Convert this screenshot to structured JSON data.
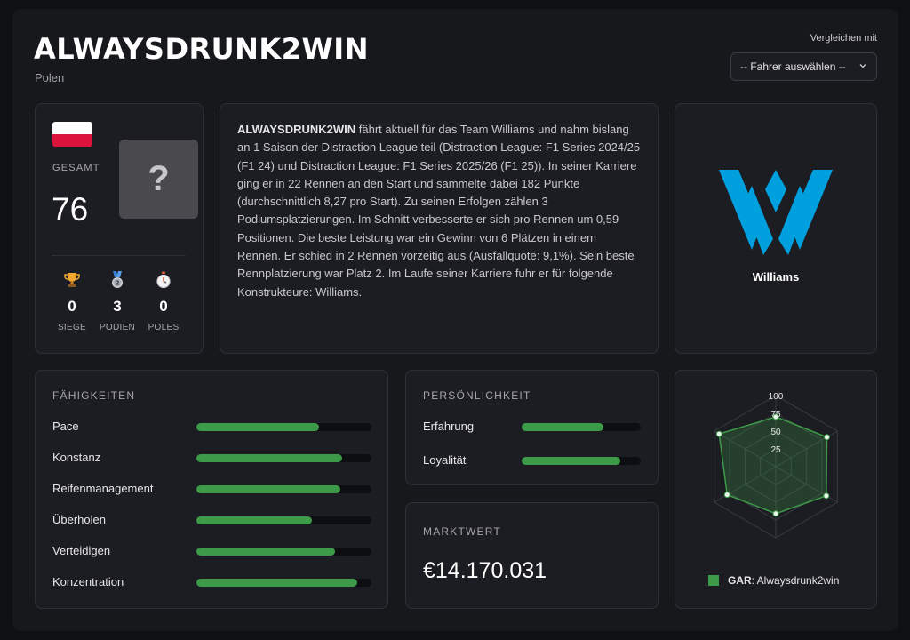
{
  "header": {
    "title": "ALWAYSDRUNK2WIN",
    "country": "Polen",
    "compare_label": "Vergleichen mit",
    "compare_select_value": "-- Fahrer auswählen --"
  },
  "profile": {
    "flag_colors": [
      "#ffffff",
      "#dc143c"
    ],
    "overall_label": "GESAMT",
    "overall_value": "76",
    "avatar_placeholder": "?",
    "stats": [
      {
        "icon": "trophy-icon",
        "value": "0",
        "label": "SIEGE"
      },
      {
        "icon": "medal-icon",
        "value": "3",
        "label": "PODIEN"
      },
      {
        "icon": "stopwatch-icon",
        "value": "0",
        "label": "POLES"
      }
    ]
  },
  "bio": {
    "name": "ALWAYSDRUNK2WIN",
    "text": " fährt aktuell für das Team Williams und nahm bislang an 1 Saison der Distraction League teil (Distraction League: F1 Series 2024/25 (F1 24) und Distraction League: F1 Series 2025/26 (F1 25)). In seiner Karriere ging er in 22 Rennen an den Start und sammelte dabei 182 Punkte (durchschnittlich 8,27 pro Start). Zu seinen Erfolgen zählen 3 Podiumsplatzierungen. Im Schnitt verbesserte er sich pro Rennen um 0,59 Positionen. Die beste Leistung war ein Gewinn von 6 Plätzen in einem Rennen. Er schied in 2 Rennen vorzeitig aus (Ausfallquote: 9,1%). Sein beste Rennplatzierung war Platz 2. Im Laufe seiner Karriere fuhr er für folgende Konstrukteure: Williams."
  },
  "team": {
    "name": "Williams",
    "logo_color": "#00a0de"
  },
  "skills": {
    "heading": "FÄHIGKEITEN",
    "items": [
      {
        "label": "Pace",
        "value": 0.7
      },
      {
        "label": "Konstanz",
        "value": 0.83
      },
      {
        "label": "Reifenmanagement",
        "value": 0.82
      },
      {
        "label": "Überholen",
        "value": 0.66
      },
      {
        "label": "Verteidigen",
        "value": 0.79
      },
      {
        "label": "Konzentration",
        "value": 0.92
      }
    ]
  },
  "personality": {
    "heading": "PERSÖNLICHKEIT",
    "items": [
      {
        "label": "Erfahrung",
        "value": 0.69
      },
      {
        "label": "Loyalität",
        "value": 0.83
      }
    ]
  },
  "market": {
    "heading": "MARKTWERT",
    "value": "€14.170.031"
  },
  "radar": {
    "ticks": [
      "25",
      "50",
      "75",
      "100"
    ],
    "values": [
      70,
      83,
      82,
      66,
      79,
      92
    ],
    "legend_code": "GAR",
    "legend_name": ": Alwaysdrunk2win",
    "color": "#3d9a48"
  }
}
